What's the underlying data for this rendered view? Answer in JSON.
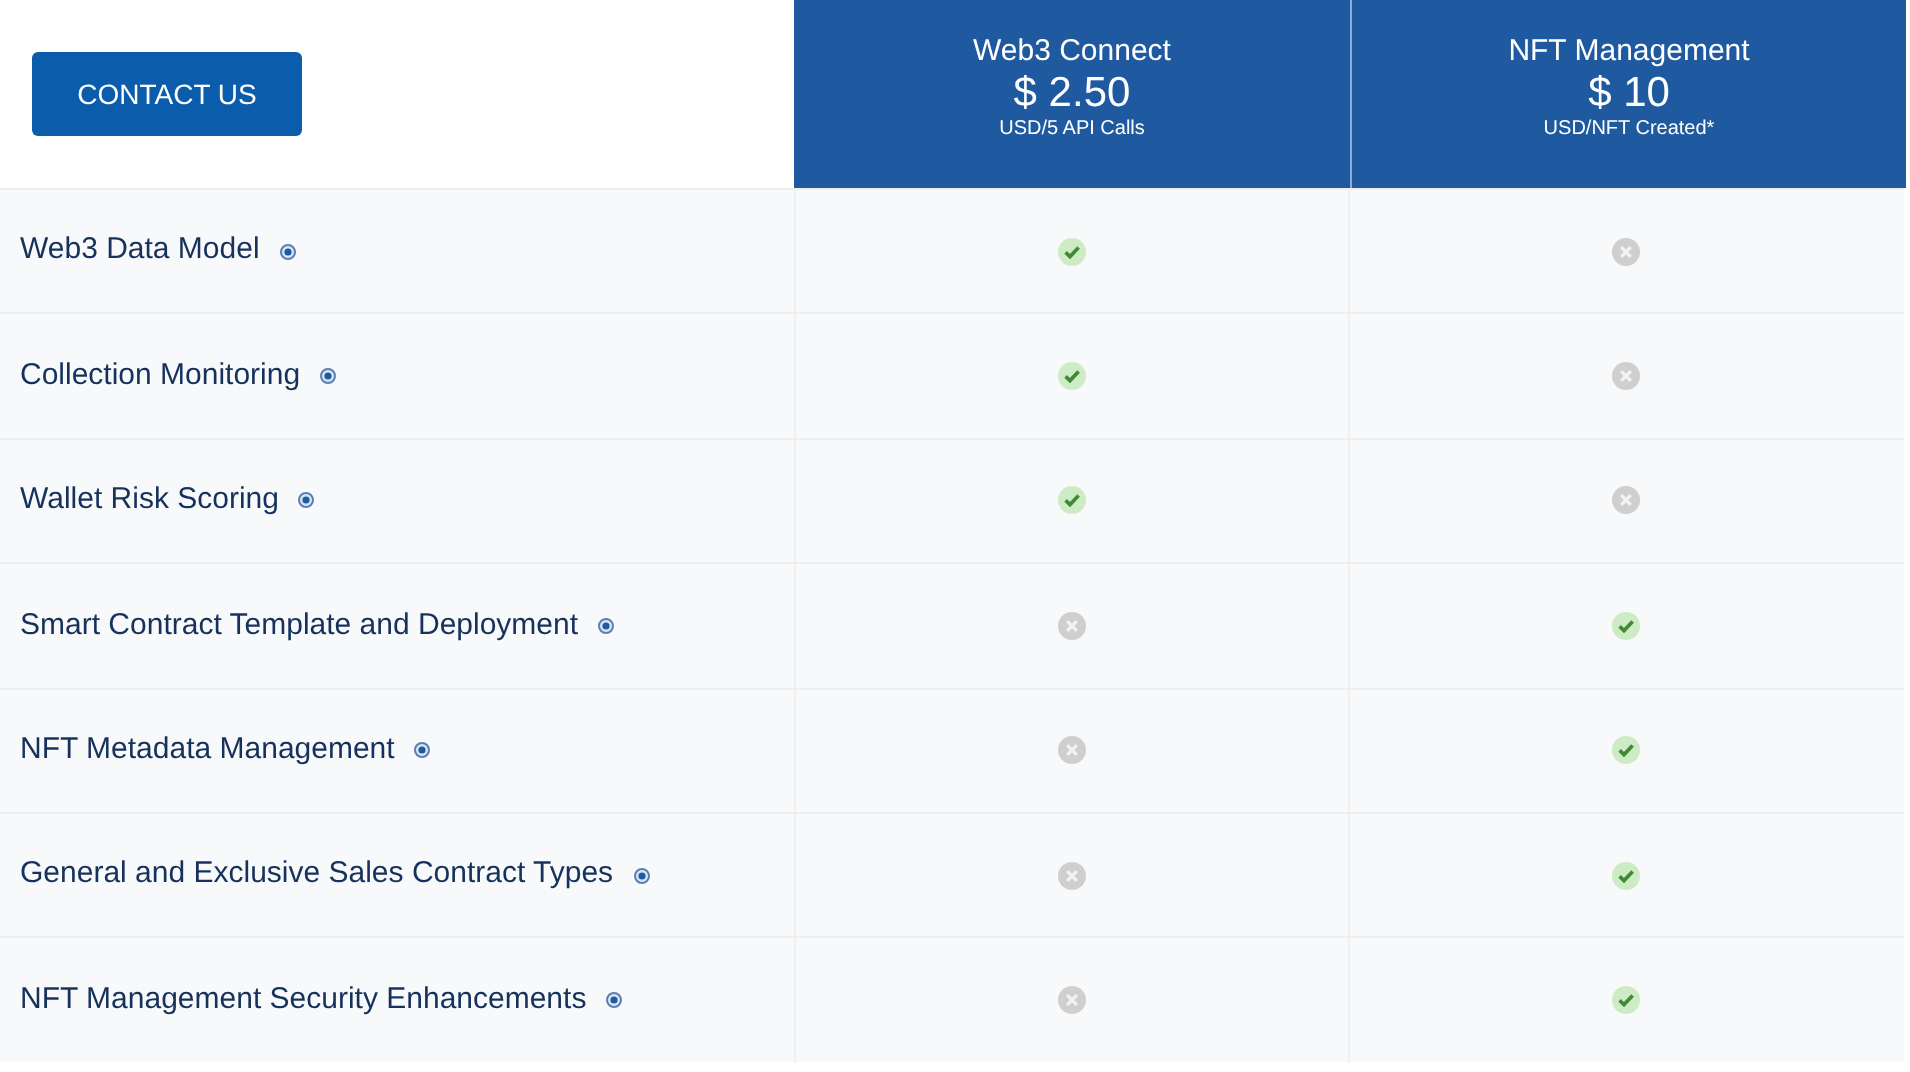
{
  "contact_button": "CONTACT US",
  "plans": [
    {
      "name": "Web3 Connect",
      "price": "$ 2.50",
      "unit": "USD/5 API Calls"
    },
    {
      "name": "NFT Management",
      "price": "$ 10",
      "unit": "USD/NFT Created*"
    }
  ],
  "features": [
    {
      "name": "Web3 Data Model",
      "included": [
        true,
        false
      ]
    },
    {
      "name": "Collection Monitoring",
      "included": [
        true,
        false
      ]
    },
    {
      "name": "Wallet Risk Scoring",
      "included": [
        true,
        false
      ]
    },
    {
      "name": "Smart Contract Template and Deployment",
      "included": [
        false,
        true
      ]
    },
    {
      "name": "NFT Metadata Management",
      "included": [
        false,
        true
      ]
    },
    {
      "name": "General and Exclusive Sales Contract Types",
      "included": [
        false,
        true
      ]
    },
    {
      "name": "NFT Management Security Enhancements",
      "included": [
        false,
        true
      ]
    }
  ]
}
